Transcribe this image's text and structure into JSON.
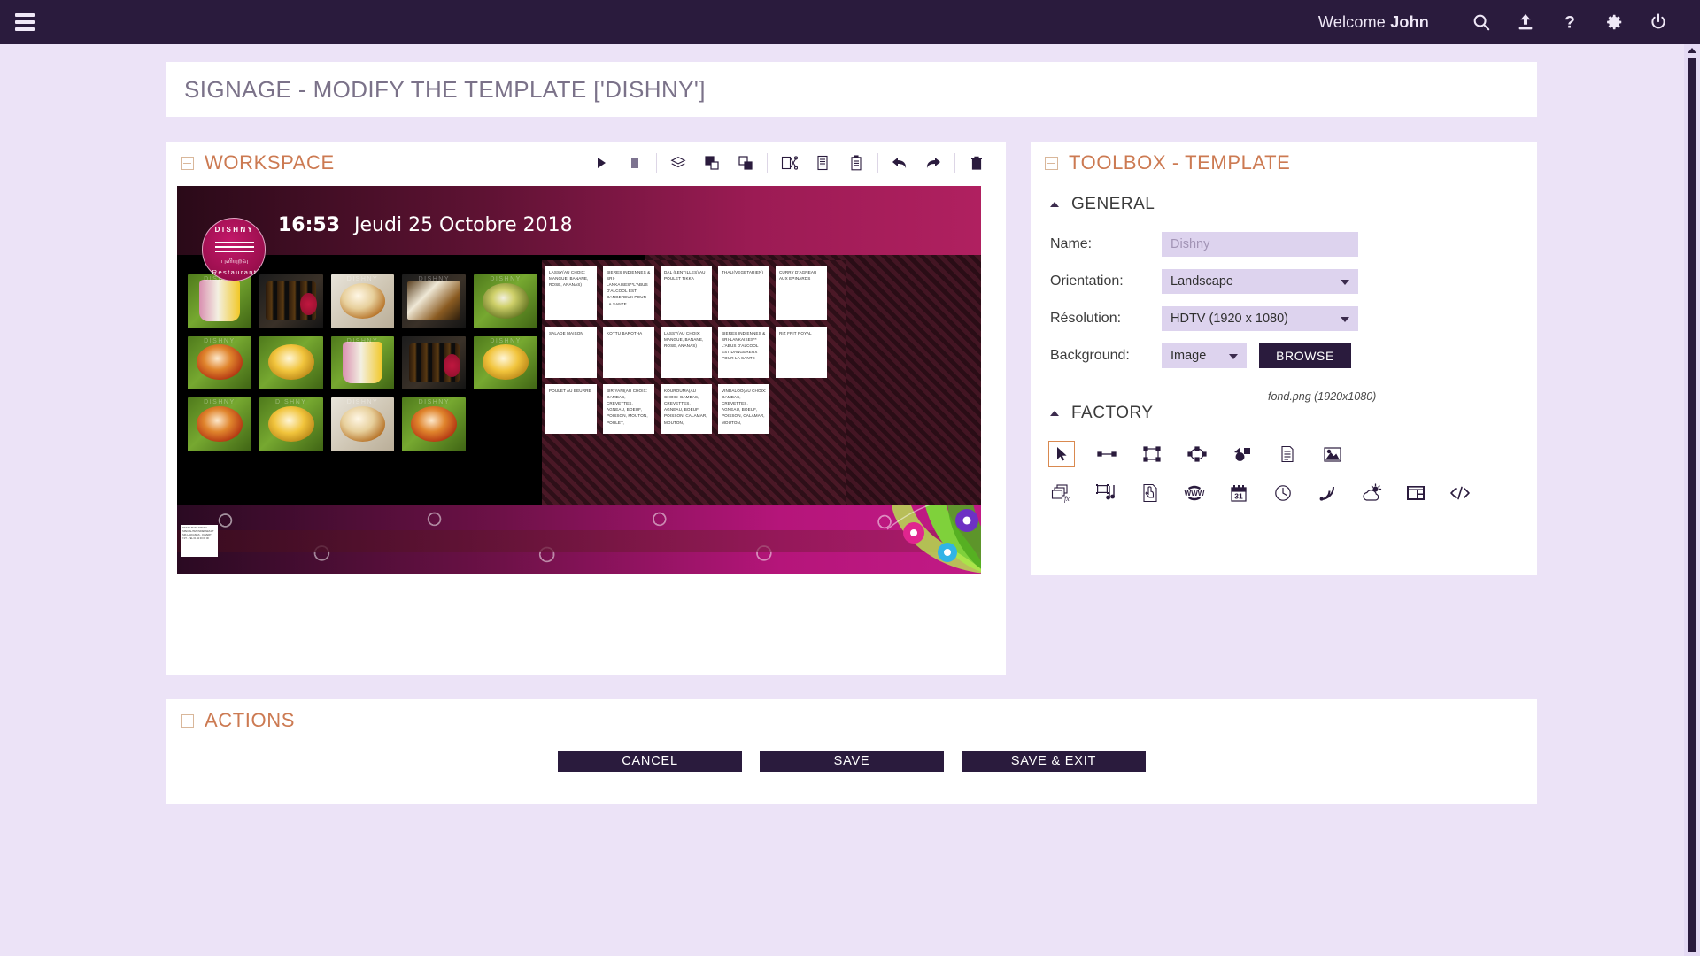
{
  "topbar": {
    "menu_icon": "hamburger-icon",
    "welcome_prefix": "Welcome ",
    "welcome_user": "John",
    "icons": [
      {
        "name": "search-icon",
        "label": "Search"
      },
      {
        "name": "upload-icon",
        "label": "Upload"
      },
      {
        "name": "help-icon",
        "label": "Help"
      },
      {
        "name": "gear-icon",
        "label": "Settings"
      },
      {
        "name": "power-icon",
        "label": "Logout"
      }
    ]
  },
  "page": {
    "title": "SIGNAGE - MODIFY THE TEMPLATE ['DISHNY']"
  },
  "workspace": {
    "title": "WORKSPACE",
    "tools": [
      {
        "name": "play-button",
        "label": "Play"
      },
      {
        "name": "stop-button",
        "label": "Stop"
      },
      {
        "name": "layers-button",
        "label": "Layers"
      },
      {
        "name": "bring-to-front-button",
        "label": "Bring to front"
      },
      {
        "name": "send-to-back-button",
        "label": "Send to back"
      },
      {
        "name": "cut-button",
        "label": "Cut"
      },
      {
        "name": "copy-button",
        "label": "Copy"
      },
      {
        "name": "paste-button",
        "label": "Paste"
      },
      {
        "name": "undo-button",
        "label": "Undo"
      },
      {
        "name": "redo-button",
        "label": "Redo"
      },
      {
        "name": "delete-button",
        "label": "Delete"
      }
    ]
  },
  "canvas": {
    "logo": {
      "top_text": "DISHNY",
      "tamil_text": "புளியுறவு",
      "bottom_text": "Restaurant"
    },
    "clock": "16:53",
    "date": "Jeudi 25 Octobre 2018",
    "photos": [
      {
        "id": "photo-1",
        "kind": "drink",
        "watermark": "DISHNY"
      },
      {
        "id": "photo-2",
        "kind": "bottles",
        "watermark": ""
      },
      {
        "id": "photo-3",
        "kind": "white",
        "watermark": "DISHNY"
      },
      {
        "id": "photo-4",
        "kind": "tray",
        "watermark": "DISHNY"
      },
      {
        "id": "photo-5",
        "kind": "green",
        "watermark": "DISHNY"
      },
      {
        "id": "photo-6",
        "kind": "red",
        "watermark": "DISHNY"
      },
      {
        "id": "photo-7",
        "kind": "yellow",
        "watermark": ""
      },
      {
        "id": "photo-8",
        "kind": "drink",
        "watermark": "DISHNY"
      },
      {
        "id": "photo-9",
        "kind": "bottles",
        "watermark": ""
      },
      {
        "id": "photo-10",
        "kind": "yellow",
        "watermark": "DISHNY"
      },
      {
        "id": "photo-11",
        "kind": "red",
        "watermark": "DISHNY"
      },
      {
        "id": "photo-12",
        "kind": "yellow",
        "watermark": "DISHNY"
      },
      {
        "id": "photo-13",
        "kind": "white",
        "watermark": "DISHNY"
      },
      {
        "id": "photo-14",
        "kind": "red",
        "watermark": "DISHNY"
      }
    ],
    "menu_rows": [
      [
        "LASSY(AU CHOIX: MANGUE, BANANE, ROSE, ANANAS)",
        "BIERES INDIENNES & SRI-LANKAISES**L'ABUS D'ALCOOL EST DANGEREUX POUR LA SANTE",
        "DAL (LENTILLES) AU POULET TIKKA",
        "THALI(VEGETARIEN)",
        "CURRY D'AGNEAU AUX EPINARDS"
      ],
      [
        "SALADE MAISON",
        "KOTTU BAROTHA",
        "LASSY(AU CHOIX: MANGUE, BANANE, ROSE, ANANAS)",
        "BIERES INDIENNES & SRI-LANKAISES** L'ABUS D'ALCOOL EST DANGEREUX POUR LA SANTE",
        "RIZ FRIT ROYAL"
      ],
      [
        "POULET AU BEURRE",
        "BIRIYANI(AU CHOIX: GAMBAS, CREVETTES, AGNEAU, BOEUF, POISSON, MOUTON, POULET,",
        "KOUROUMA(AU CHOIX: GAMBAS, CREVETTES, AGNEAU, BOEUF, POISSON, CALAMAR, MOUTON,",
        "VINDALOO(AU CHOIX: GAMBAS, CREVETTES, AGNEAU, BOEUF, POISSON, CALAMAR, MOUTON,"
      ]
    ],
    "band_note": "RESTAURANT DISHNY - SPECIALITES INDIENNES ET SRI-LANKAISES - OUVERT 7J/7 - TEL 01 42 00 00 00"
  },
  "toolbox": {
    "title": "TOOLBOX - TEMPLATE",
    "general": {
      "section_label": "GENERAL",
      "name_label": "Name:",
      "name_value": "",
      "name_placeholder": "Dishny",
      "orientation_label": "Orientation:",
      "orientation_value": "Landscape",
      "resolution_label": "Résolution:",
      "resolution_value": "HDTV (1920 x 1080)",
      "background_label": "Background:",
      "background_value": "Image",
      "browse_label": "BROWSE",
      "background_filename": "fond.png (1920x1080)"
    },
    "factory": {
      "section_label": "FACTORY",
      "row1": [
        {
          "name": "select-tool-icon",
          "label": "Select",
          "selected": true
        },
        {
          "name": "line-tool-icon",
          "label": "Line",
          "selected": false
        },
        {
          "name": "rectangle-tool-icon",
          "label": "Rectangle",
          "selected": false
        },
        {
          "name": "ellipse-tool-icon",
          "label": "Ellipse",
          "selected": false
        },
        {
          "name": "shape-tool-icon",
          "label": "Shape",
          "selected": false
        },
        {
          "name": "text-tool-icon",
          "label": "Text",
          "selected": false
        },
        {
          "name": "image-tool-icon",
          "label": "Image",
          "selected": false
        }
      ],
      "row2": [
        {
          "name": "slideshow-fx-icon",
          "label": "Slideshow"
        },
        {
          "name": "media-video-icon",
          "label": "Video / Audio"
        },
        {
          "name": "touch-zone-icon",
          "label": "Touch zone"
        },
        {
          "name": "web-www-icon",
          "label": "Web page"
        },
        {
          "name": "calendar-icon",
          "label": "Calendar",
          "day": "31"
        },
        {
          "name": "clock-icon",
          "label": "Clock"
        },
        {
          "name": "rss-icon",
          "label": "RSS feed"
        },
        {
          "name": "weather-icon",
          "label": "Weather"
        },
        {
          "name": "widget-icon",
          "label": "Widget"
        },
        {
          "name": "code-icon",
          "label": "Code"
        }
      ]
    }
  },
  "actions": {
    "title": "ACTIONS",
    "buttons": [
      {
        "name": "cancel-button",
        "label": "CANCEL"
      },
      {
        "name": "save-button",
        "label": "SAVE"
      },
      {
        "name": "save-exit-button",
        "label": "SAVE & EXIT"
      }
    ]
  },
  "colors": {
    "topbar": "#2a1b3d",
    "page_bg": "#ece3f7",
    "panel_title": "#cc7a52",
    "field_bg": "#ddd3ee",
    "accent_dark": "#2a1b3d",
    "selected_border": "#d9894f"
  }
}
